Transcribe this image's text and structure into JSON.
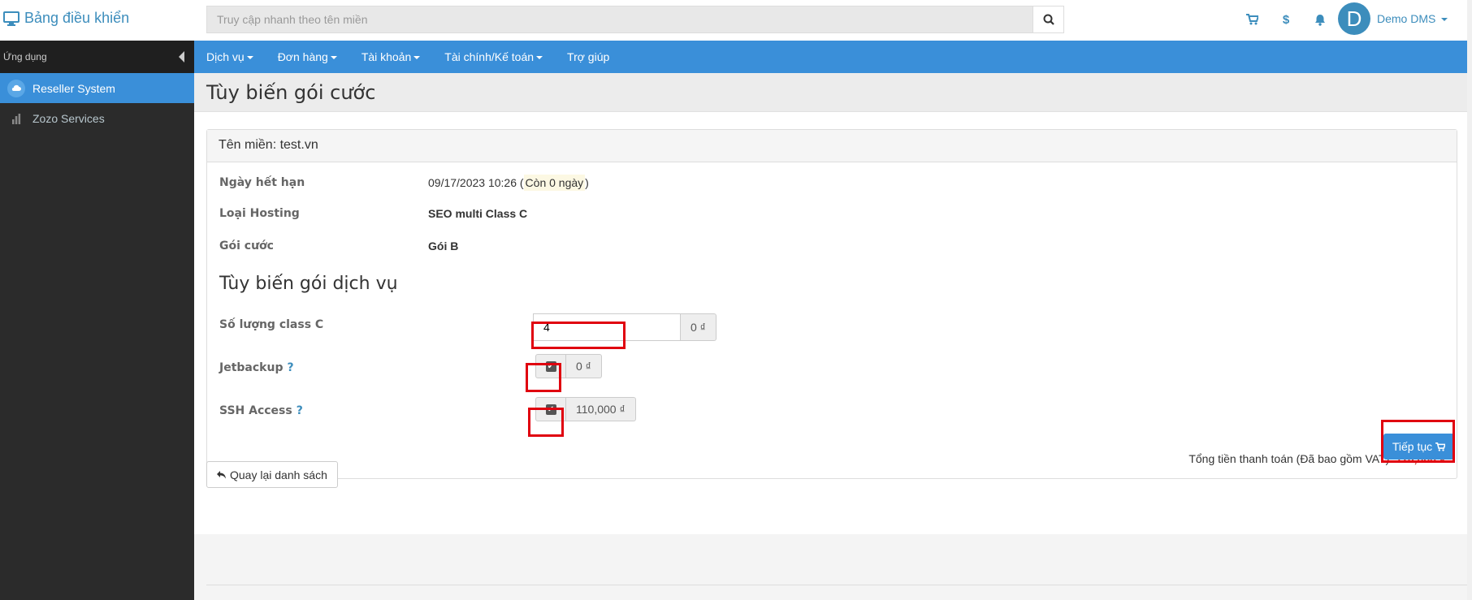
{
  "brand": {
    "title": "Bảng điều khiển"
  },
  "search": {
    "placeholder": "Truy cập nhanh theo tên miền"
  },
  "user": {
    "initial": "D",
    "name": "Demo DMS"
  },
  "top_icons": {
    "cart": "$"
  },
  "sidebar": {
    "header": "Ứng dụng",
    "items": [
      {
        "label": "Reseller System",
        "icon": "cloud-icon",
        "active": true
      },
      {
        "label": "Zozo Services",
        "icon": "chart-icon",
        "active": false
      }
    ]
  },
  "nav": {
    "items": [
      {
        "label": "Dịch vụ"
      },
      {
        "label": "Đơn hàng"
      },
      {
        "label": "Tài khoản"
      },
      {
        "label": "Tài chính/Kế toán"
      },
      {
        "label": "Trợ giúp"
      }
    ]
  },
  "page": {
    "title": "Tùy biến gói cước"
  },
  "domain_box": {
    "header": "Tên miền: test.vn",
    "expiry_label": "Ngày hết hạn",
    "expiry_date": "09/17/2023 10:26 (",
    "expiry_remaining": "Còn 0 ngày",
    "expiry_close": ")",
    "hosting_label": "Loại Hosting",
    "hosting_value": "SEO multi Class C",
    "plan_label": "Gói cước",
    "plan_value": "Gói B"
  },
  "customize": {
    "title": "Tùy biến gói dịch vụ",
    "class_c_label": "Số lượng class C",
    "class_c_value": "4",
    "class_c_price": "0 ₫",
    "jetbackup_label": "Jetbackup",
    "jetbackup_price": "0 ₫",
    "jetbackup_checked": true,
    "ssh_label": "SSH Access",
    "ssh_price": "110,000 ₫",
    "ssh_checked": true,
    "help": "?"
  },
  "total": {
    "label": "Tổng tiền thanh toán (Đã bao gồm VAT):",
    "amount": "110,000 ₫"
  },
  "buttons": {
    "continue": "Tiếp tục",
    "back": "Quay lại danh sách"
  },
  "colors": {
    "primary": "#3a8fd9",
    "highlight_red": "#e0000f",
    "sidebar_bg": "#2b2b2b"
  }
}
